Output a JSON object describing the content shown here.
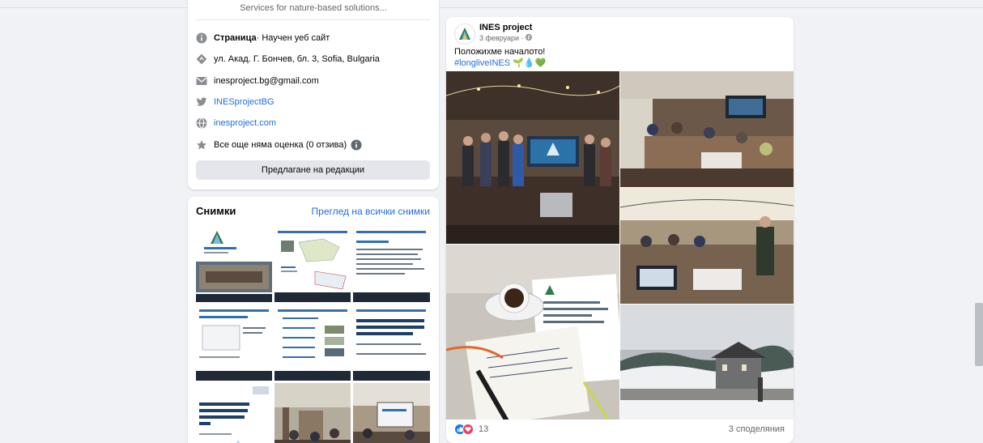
{
  "intro": {
    "tail_text": "Services for nature-based solutions...",
    "page_label": "Страница",
    "page_category": " · Научен уеб сайт",
    "address": "ул. Акад. Г. Бончев, бл. 3, Sofia, Bulgaria",
    "email": "inesproject.bg@gmail.com",
    "twitter": "INESprojectBG",
    "website": "inesproject.com",
    "rating": "Все още няма оценка (0 отзива)",
    "edit_button": "Предлагане на редакции"
  },
  "photos": {
    "title": "Снимки",
    "see_all": "Преглед на всички снимки"
  },
  "post": {
    "author": "INES project",
    "date": "3 февруари · ",
    "text": "Положихме началото!",
    "hashtag": "#longliveINES 🌱💧💚",
    "reaction_count": "13",
    "shares": "3 споделяния"
  },
  "colors": {
    "link": "#216fdb",
    "like": "#1877f2",
    "love": "#f33e58",
    "background": "#f0f2f5"
  },
  "icons": [
    "info-icon",
    "location-icon",
    "mail-icon",
    "twitter-icon",
    "globe-icon",
    "star-icon",
    "like-icon",
    "love-icon",
    "globe-small-icon"
  ]
}
